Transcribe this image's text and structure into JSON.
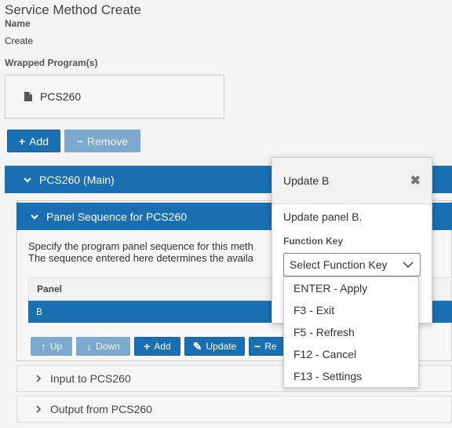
{
  "page": {
    "title": "Service Method Create",
    "name_label": "Name",
    "name_value": "Create",
    "wrapped_label": "Wrapped Program(s)",
    "program": "PCS260"
  },
  "top_actions": {
    "add": "Add",
    "remove": "Remove"
  },
  "main_section": {
    "title": "PCS260 (Main)"
  },
  "panel_sequence": {
    "title": "Panel Sequence for PCS260",
    "desc_line1": "Specify the program panel sequence for this meth",
    "desc_line2": "The sequence entered here determines the availa",
    "table_header": "Panel",
    "rows": [
      "B"
    ],
    "buttons": {
      "up": "Up",
      "down": "Down",
      "add": "Add",
      "update": "Update",
      "remove": "Re"
    }
  },
  "sections": {
    "input": "Input to PCS260",
    "output": "Output from PCS260"
  },
  "modal": {
    "title": "Update B",
    "description": "Update panel B.",
    "function_key_label": "Function Key",
    "select_placeholder": "Select Function Key",
    "options": [
      "ENTER - Apply",
      "F3 - Exit",
      "F5 - Refresh",
      "F12 - Cancel",
      "F13 - Settings"
    ]
  },
  "colors": {
    "primary": "#1a6fb3",
    "disabled": "#7ea9cf"
  }
}
